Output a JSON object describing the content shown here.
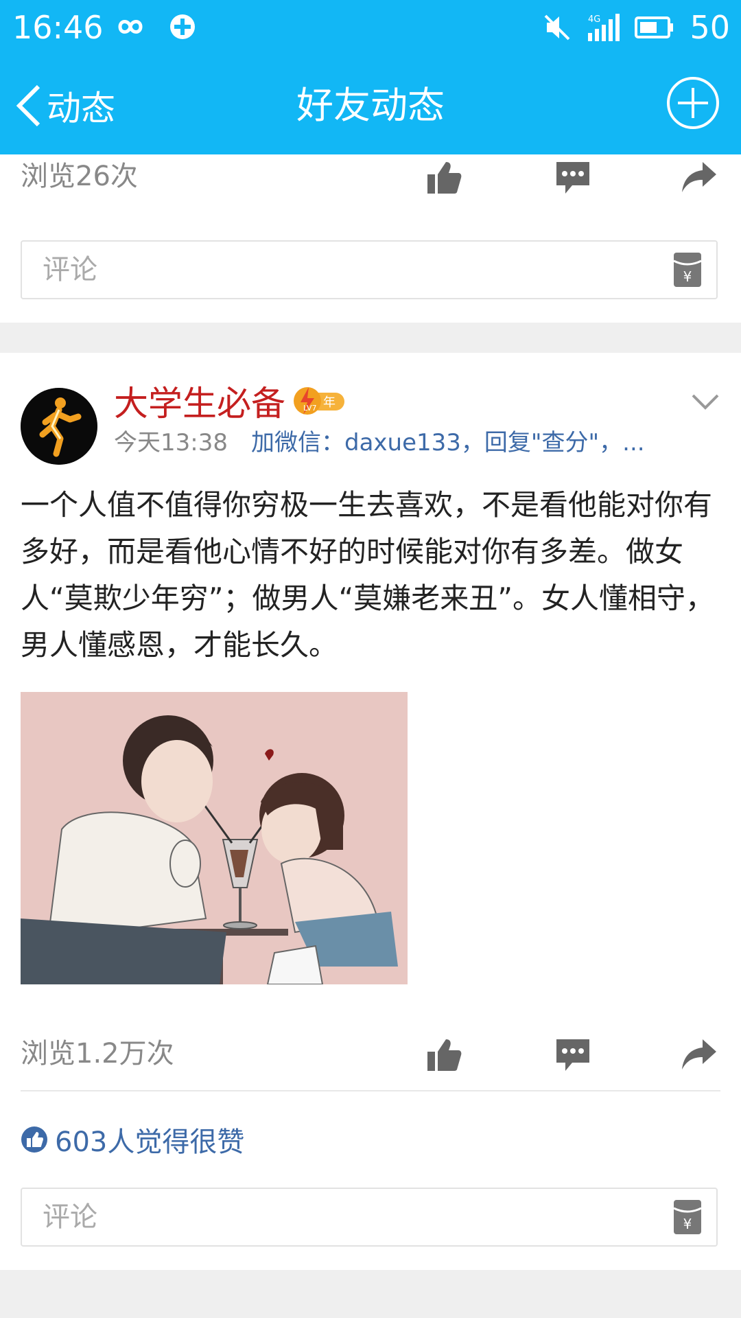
{
  "status_bar": {
    "time": "16:46",
    "network": "4G",
    "battery": "50"
  },
  "header": {
    "back_label": "动态",
    "title": "好友动态"
  },
  "prev_post": {
    "views": "浏览26次",
    "comment_placeholder": "评论"
  },
  "post": {
    "author": "大学生必备",
    "level_badge": "LV7",
    "level_badge_suffix": "年",
    "time": "今天13:38",
    "source": "加微信：daxue133，回复\"查分\"，...",
    "text": "一个人值不值得你穷极一生去喜欢，不是看他能对你有多好，而是看他心情不好的时候能对你有多差。做女人“莫欺少年穷”；做男人“莫嫌老来丑”。女人懂相守，男人懂感恩，才能长久。",
    "views": "浏览1.2万次",
    "likes": "603人觉得很赞",
    "comment_placeholder": "评论"
  },
  "colors": {
    "brand": "#12b7f5",
    "author_red": "#c41f1f",
    "link_blue": "#3d6aa8",
    "icon_gray": "#666666"
  }
}
